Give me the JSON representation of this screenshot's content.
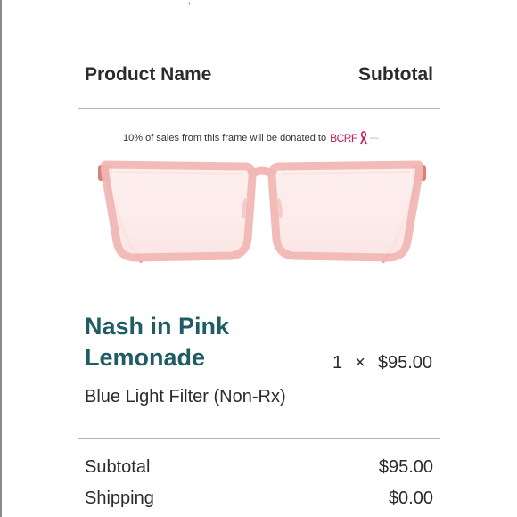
{
  "top_fragment": "` ,",
  "table_header": {
    "product_label": "Product Name",
    "subtotal_label": "Subtotal"
  },
  "product_image": {
    "donation_text": "10% of sales from this frame will be donated to",
    "donation_logo": "BCRF",
    "frame_color": "#f2b8b4"
  },
  "line_item": {
    "name": "Nash in Pink Lemonade",
    "quantity": "1",
    "times_symbol": "×",
    "price": "$95.00",
    "variant": "Blue Light Filter (Non-Rx)"
  },
  "totals": {
    "subtotal_label": "Subtotal",
    "subtotal_value": "$95.00",
    "shipping_label": "Shipping",
    "shipping_value": "$0.00"
  },
  "colors": {
    "product_name": "#1f5c63",
    "bcrf_pink": "#c2185b"
  }
}
